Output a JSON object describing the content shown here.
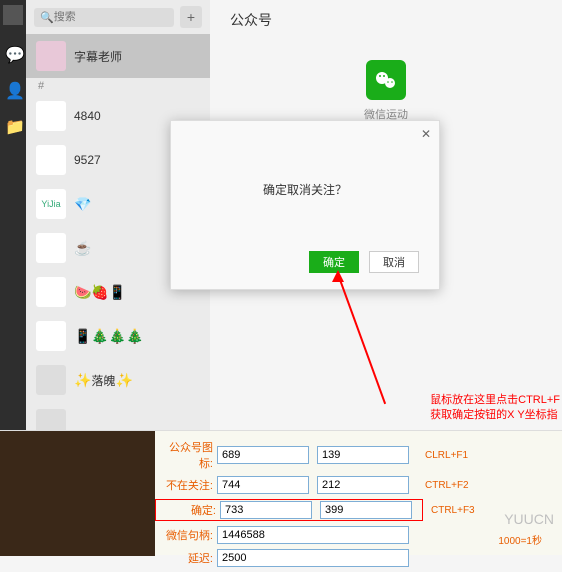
{
  "search": {
    "placeholder": "搜索"
  },
  "main": {
    "title": "公众号",
    "account_label": "微信运动"
  },
  "contacts": [
    {
      "name": "字幕老师"
    },
    {
      "name": "4840"
    },
    {
      "name": "9527"
    },
    {
      "name": "Yi Jia"
    },
    {
      "name": ""
    },
    {
      "name": ""
    },
    {
      "name": ""
    },
    {
      "name": "落魄"
    },
    {
      "name": ""
    }
  ],
  "dialog": {
    "message": "确定取消关注？",
    "ok": "确定",
    "cancel": "取消"
  },
  "annotation": {
    "line1": "鼠标放在这里点击CTRL+F",
    "line2": "获取确定按钮的X Y坐标指"
  },
  "form": {
    "labels": {
      "icon": "公众号图标:",
      "not_follow": "不在关注:",
      "confirm": "确定:",
      "secret": "微信句柄:",
      "delay": "延迟:"
    },
    "values": {
      "icon_x": "689",
      "icon_y": "139",
      "nf_x": "744",
      "nf_y": "212",
      "ok_x": "733",
      "ok_y": "399",
      "secret": "1446588",
      "delay": "2500"
    },
    "shortcuts": {
      "s1": "CLRL+F1",
      "s2": "CTRL+F2",
      "s3": "CTRL+F3"
    },
    "timing": "1000=1秒",
    "watermark": "YUUCN"
  }
}
